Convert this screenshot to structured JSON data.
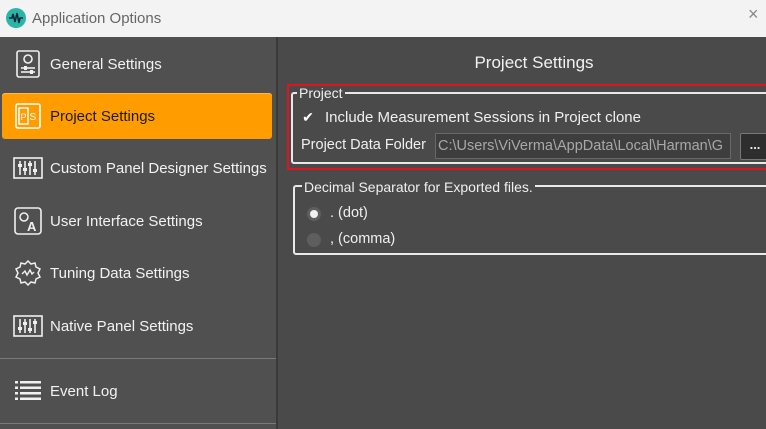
{
  "window": {
    "title": "Application Options",
    "close_glyph": "×"
  },
  "sidebar": {
    "items": [
      {
        "label": "General Settings",
        "icon": "general-settings-icon"
      },
      {
        "label": "Project Settings",
        "icon": "project-settings-icon",
        "active": true
      },
      {
        "label": "Custom Panel Designer Settings",
        "icon": "panel-designer-icon"
      },
      {
        "label": "User Interface Settings",
        "icon": "user-interface-icon"
      },
      {
        "label": "Tuning Data Settings",
        "icon": "tuning-data-icon"
      },
      {
        "label": "Native Panel Settings",
        "icon": "native-panel-icon"
      },
      {
        "label": "Event Log",
        "icon": "event-log-icon"
      }
    ]
  },
  "main": {
    "title": "Project Settings",
    "project_group": {
      "title": "Project",
      "include_sessions_label": "Include Measurement Sessions in Project clone",
      "include_sessions_checked": true,
      "folder_label": "Project Data Folder",
      "folder_value": "C:\\Users\\ViVerma\\AppData\\Local\\Harman\\G",
      "browse_label": "..."
    },
    "decimal_group": {
      "title": "Decimal Separator for Exported files.",
      "options": [
        {
          "label": ". (dot)",
          "checked": true
        },
        {
          "label": ", (comma)",
          "checked": false
        }
      ]
    }
  },
  "colors": {
    "accent": "#ff9d00",
    "highlight_border": "#e0141e",
    "background": "#4a4a4a"
  }
}
